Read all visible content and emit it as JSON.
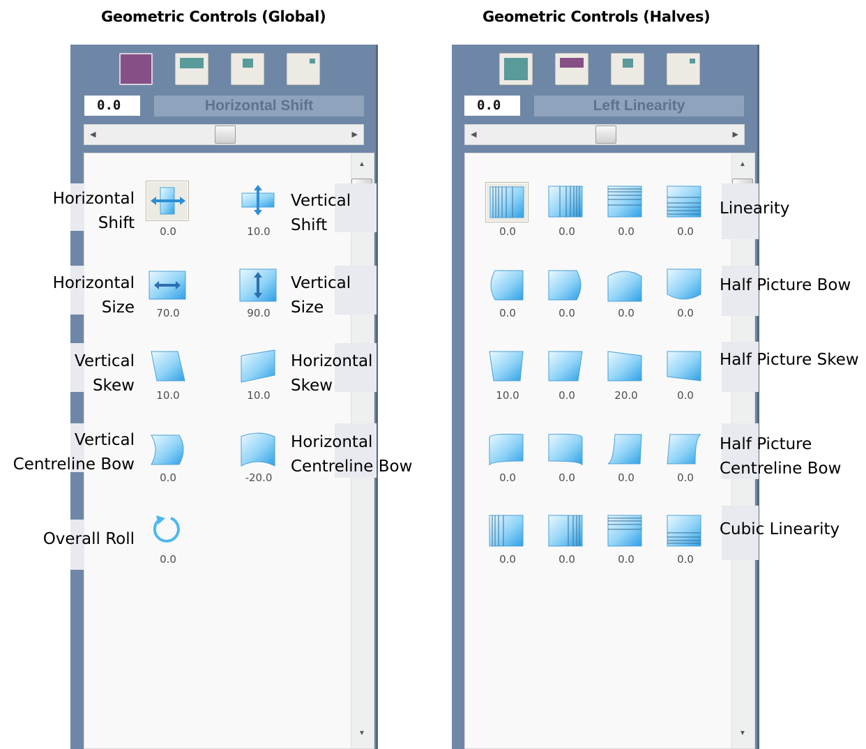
{
  "global": {
    "heading": "Geometric Controls (Global)",
    "value": "0.0",
    "name": "Horizontal Shift",
    "items": [
      {
        "label": "Horizontal\nShift",
        "value": "0.0"
      },
      {
        "label": "Vertical\nShift",
        "value": "10.0"
      },
      {
        "label": "Horizontal\nSize",
        "value": "70.0"
      },
      {
        "label": "Vertical\nSize",
        "value": "90.0"
      },
      {
        "label": "Vertical\nSkew",
        "value": "10.0"
      },
      {
        "label": "Horizontal\nSkew",
        "value": "10.0"
      },
      {
        "label": "Vertical\nCentreline Bow",
        "value": "0.0"
      },
      {
        "label": "Horizontal\nCentreline Bow",
        "value": "-20.0"
      },
      {
        "label": "Overall Roll",
        "value": "0.0"
      }
    ]
  },
  "halves": {
    "heading": "Geometric Controls (Halves)",
    "value": "0.0",
    "name": "Left Linearity",
    "rows": [
      {
        "label": "Linearity",
        "values": [
          "0.0",
          "0.0",
          "0.0",
          "0.0"
        ]
      },
      {
        "label": "Half Picture Bow",
        "values": [
          "0.0",
          "0.0",
          "0.0",
          "0.0"
        ]
      },
      {
        "label": "Half Picture Skew",
        "values": [
          "10.0",
          "0.0",
          "20.0",
          "0.0"
        ]
      },
      {
        "label": "Half Picture\nCentreline Bow",
        "values": [
          "0.0",
          "0.0",
          "0.0",
          "0.0"
        ]
      },
      {
        "label": "Cubic Linearity",
        "values": [
          "0.0",
          "0.0",
          "0.0",
          "0.0"
        ]
      }
    ]
  },
  "colors": {
    "panel": "#6f87a6",
    "active_tool": "#864f86",
    "icon_blue": "#3aa6ea"
  }
}
